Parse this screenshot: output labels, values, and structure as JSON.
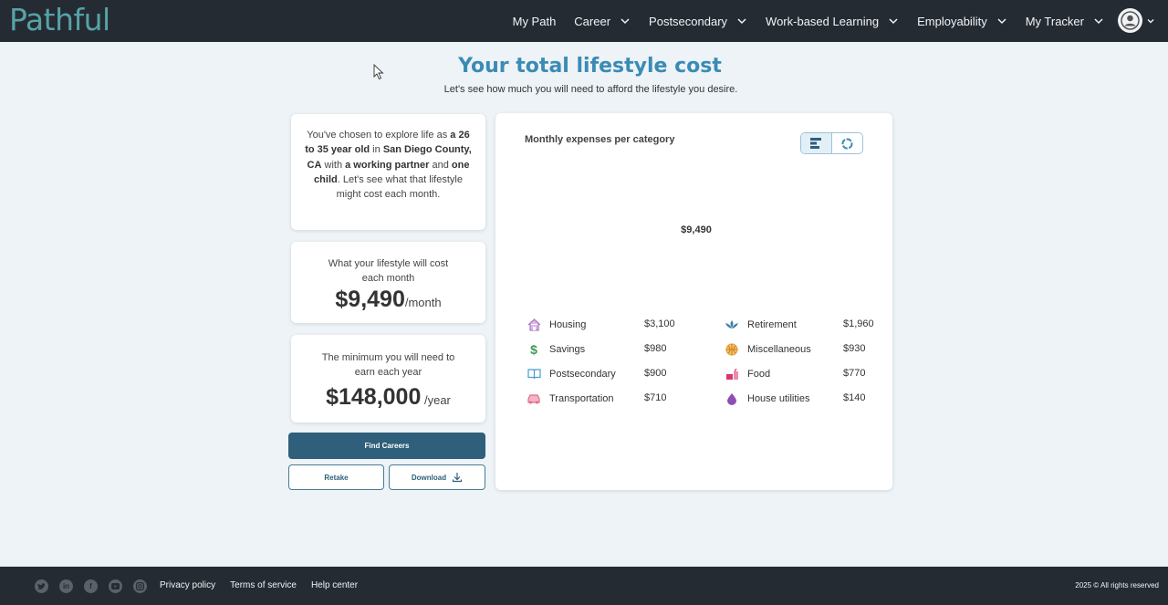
{
  "header": {
    "logo": "Pathful",
    "nav": [
      {
        "label": "My Path",
        "dropdown": false
      },
      {
        "label": "Career",
        "dropdown": true
      },
      {
        "label": "Postsecondary",
        "dropdown": true
      },
      {
        "label": "Work-based Learning",
        "dropdown": true
      },
      {
        "label": "Employability",
        "dropdown": true
      },
      {
        "label": "My Tracker",
        "dropdown": true
      }
    ]
  },
  "page": {
    "title": "Your total lifestyle cost",
    "subtitle": "Let's see how much you will need to afford the lifestyle you desire."
  },
  "intro": {
    "p1": "You've chosen to explore life as ",
    "age": "a 26 to 35 year old",
    "p2": " in ",
    "location": "San Diego County, CA",
    "p3": " with ",
    "partner": "a working partner",
    "p4": " and ",
    "children": "one child",
    "p5": ". Let's see what that lifestyle might cost each month."
  },
  "monthly": {
    "label": "What your lifestyle will cost each month",
    "amount": "$9,490",
    "unit": "/month"
  },
  "yearly": {
    "label": "The minimum you will need to earn each year",
    "amount": "$148,000",
    "unit": " /year"
  },
  "buttons": {
    "find_careers": "Find Careers",
    "retake": "Retake",
    "download": "Download"
  },
  "chart": {
    "title": "Monthly expenses per category",
    "center_total": "$9,490"
  },
  "chart_data": {
    "type": "pie",
    "categories": [
      "Housing",
      "Savings",
      "Postsecondary",
      "Transportation",
      "Retirement",
      "Miscellaneous",
      "Food",
      "House utilities"
    ],
    "values": [
      3100,
      980,
      900,
      710,
      1960,
      930,
      770,
      140
    ],
    "labels": [
      "$3,100",
      "$980",
      "$900",
      "$710",
      "$1,960",
      "$930",
      "$770",
      "$140"
    ],
    "icons": [
      "house-icon",
      "dollar-icon",
      "book-icon",
      "car-icon",
      "lotus-icon",
      "basketball-icon",
      "food-icon",
      "droplet-icon"
    ],
    "colors": [
      "#b07cc6",
      "#3a9a5b",
      "#4d9bd1",
      "#e06c8a",
      "#3d7ea6",
      "#e8a23b",
      "#d9376e",
      "#8e4fb4"
    ]
  },
  "footer": {
    "social": [
      "twitter-icon",
      "linkedin-icon",
      "facebook-icon",
      "youtube-icon",
      "instagram-icon"
    ],
    "links": [
      "Privacy policy",
      "Terms of service",
      "Help center"
    ],
    "copyright": "2025 © All rights reserved"
  }
}
